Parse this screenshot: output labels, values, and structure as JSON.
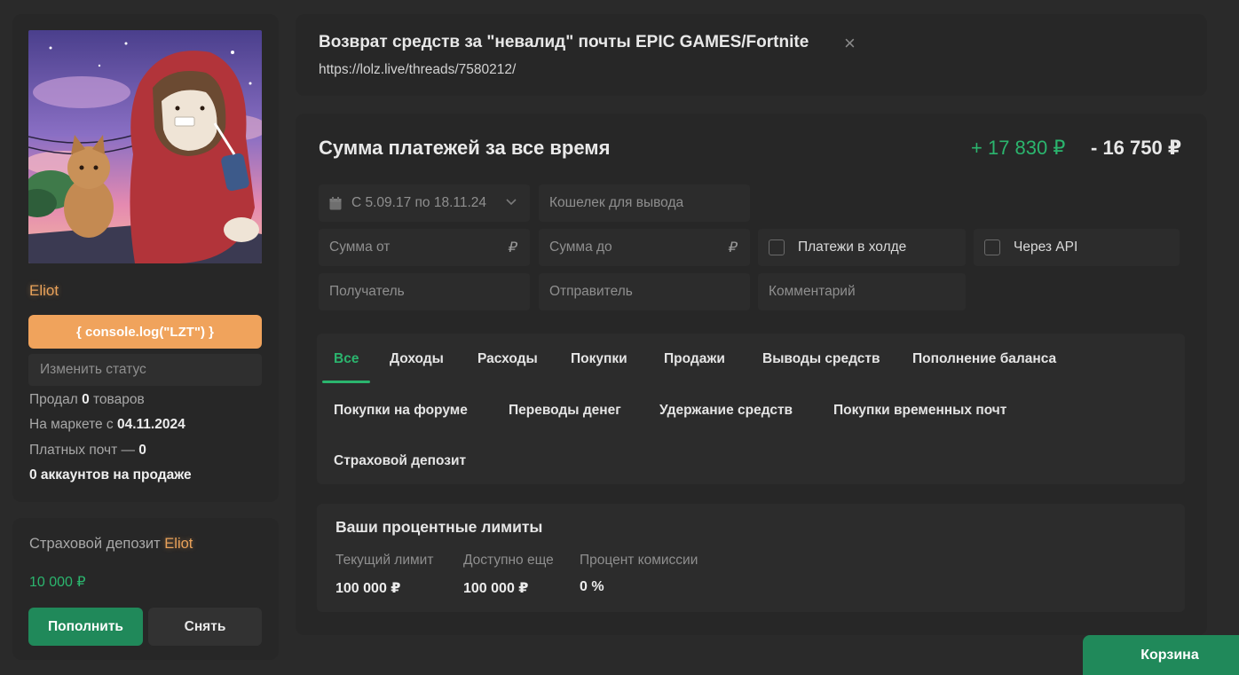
{
  "profile": {
    "username": "Eliot",
    "status_banner": "{ console.log(\"LZT\") }",
    "status_placeholder": "Изменить статус",
    "sold_prefix": "Продал",
    "sold_count": "0",
    "sold_suffix": "товаров",
    "market_prefix": "На маркете с",
    "market_date": "04.11.2024",
    "paid_mail_prefix": "Платных почт —",
    "paid_mail_count": "0",
    "accounts_on_sale": "0 аккаунтов на продаже"
  },
  "deposit": {
    "title": "Страховой депозит",
    "name": "Eliot",
    "amount": "10 000 ₽",
    "topup_label": "Пополнить",
    "withdraw_label": "Снять"
  },
  "thread": {
    "title": "Возврат средств за \"невалид\" почты EPIC GAMES/Fortnite",
    "close_icon": "×",
    "url": "https://lolz.live/threads/7580212/"
  },
  "payments": {
    "title": "Сумма платежей за все время",
    "income": "+ 17 830 ₽",
    "expense": "- 16 750 ₽",
    "filters": {
      "date_range": "С 5.09.17 по 18.11.24",
      "wallet_placeholder": "Кошелек для вывода",
      "sum_from_placeholder": "Сумма от",
      "sum_to_placeholder": "Сумма до",
      "currency_symbol": "₽",
      "hold_label": "Платежи в холде",
      "api_label": "Через API",
      "recipient_placeholder": "Получатель",
      "sender_placeholder": "Отправитель",
      "comment_placeholder": "Комментарий"
    },
    "tabs": [
      {
        "label": "Все"
      },
      {
        "label": "Доходы"
      },
      {
        "label": "Расходы"
      },
      {
        "label": "Покупки"
      },
      {
        "label": "Продажи"
      },
      {
        "label": "Выводы средств"
      },
      {
        "label": "Пополнение баланса"
      },
      {
        "label": "Покупки на форуме"
      },
      {
        "label": "Переводы денег"
      },
      {
        "label": "Удержание средств"
      },
      {
        "label": "Покупки временных почт"
      },
      {
        "label": "Страховой депозит"
      }
    ],
    "active_tab": "Все"
  },
  "limits": {
    "title": "Ваши процентные лимиты",
    "items": [
      {
        "label": "Текущий лимит",
        "value": "100 000 ₽"
      },
      {
        "label": "Доступно еще",
        "value": "100 000 ₽"
      },
      {
        "label": "Процент комиссии",
        "value": "0 %"
      }
    ]
  },
  "cart": {
    "label": "Корзина"
  },
  "colors": {
    "accent_green": "#2bb56e",
    "button_green": "#20895a",
    "username_orange": "#e9a25a",
    "status_banner": "#f0a35c",
    "background": "#2a2a2a",
    "panel": "#272727"
  }
}
